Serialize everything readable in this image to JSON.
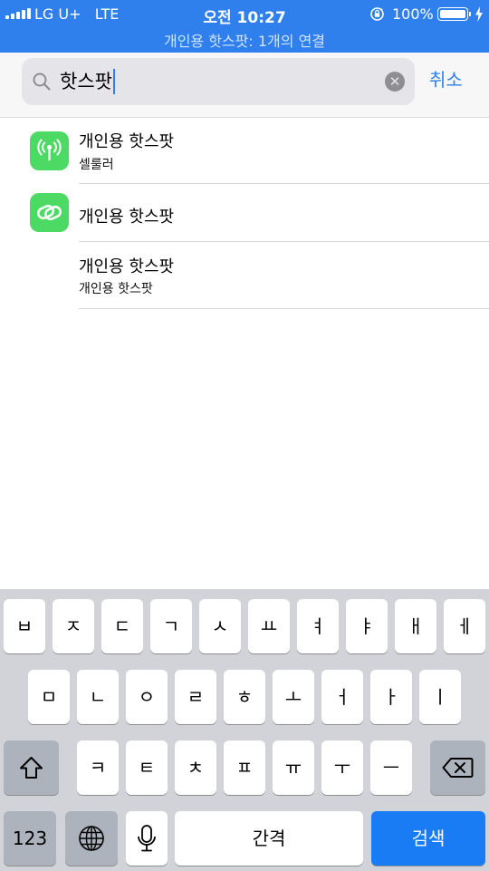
{
  "status_bar": {
    "carrier": "LG U+",
    "network": "LTE",
    "time": "오전 10:27",
    "battery": "100%",
    "banner": "개인용 핫스팟: 1개의 연결"
  },
  "search": {
    "value": "핫스팟",
    "cancel_label": "취소"
  },
  "results": [
    {
      "title": "개인용 핫스팟",
      "subtitle": "셀룰러",
      "icon": "cellular-antenna-icon"
    },
    {
      "title": "개인용 핫스팟",
      "subtitle": "",
      "icon": "hotspot-link-icon"
    },
    {
      "title": "개인용 핫스팟",
      "subtitle": "개인용 핫스팟",
      "icon": ""
    }
  ],
  "keyboard": {
    "row1": [
      "ㅂ",
      "ㅈ",
      "ㄷ",
      "ㄱ",
      "ㅅ",
      "ㅛ",
      "ㅕ",
      "ㅑ",
      "ㅐ",
      "ㅔ"
    ],
    "row2": [
      "ㅁ",
      "ㄴ",
      "ㅇ",
      "ㄹ",
      "ㅎ",
      "ㅗ",
      "ㅓ",
      "ㅏ",
      "ㅣ"
    ],
    "row3": [
      "ㅋ",
      "ㅌ",
      "ㅊ",
      "ㅍ",
      "ㅠ",
      "ㅜ",
      "ㅡ"
    ],
    "numbers_label": "123",
    "space_label": "간격",
    "search_label": "검색",
    "shift_icon": "shift-icon",
    "delete_icon": "backspace-icon",
    "globe_icon": "globe-icon",
    "mic_icon": "microphone-icon"
  },
  "colors": {
    "accent": "#2f80ed",
    "icon_green": "#4cd964",
    "search_key": "#1a7cf5"
  }
}
